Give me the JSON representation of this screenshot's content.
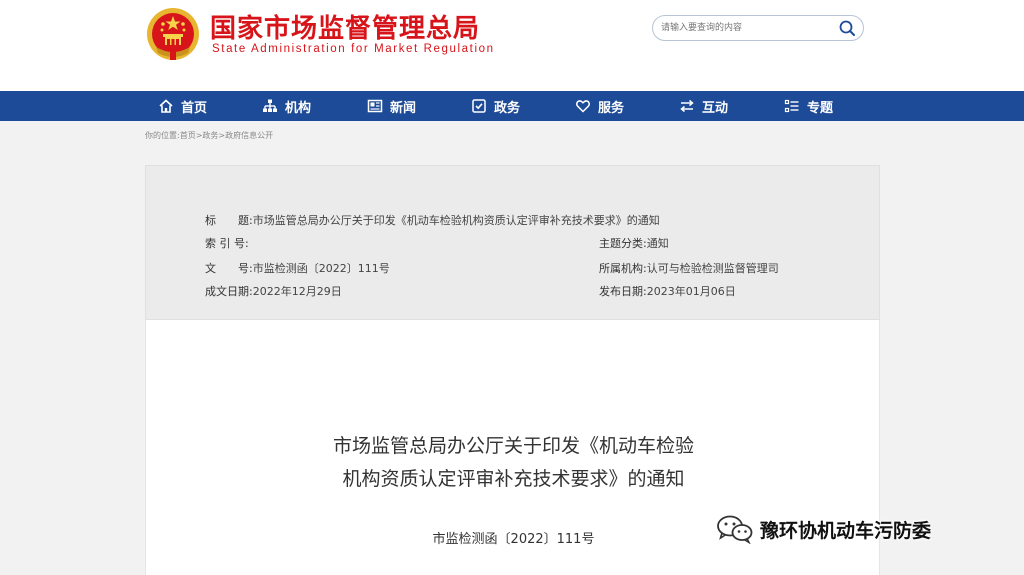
{
  "header": {
    "title_cn": "国家市场监督管理总局",
    "title_en": "State Administration for Market Regulation",
    "logo_icon": "national-emblem",
    "colors": {
      "brand_red": "#d7141a",
      "nav_blue": "#1e4b97"
    }
  },
  "search": {
    "placeholder": "请输入要查询的内容",
    "button_icon": "search-icon"
  },
  "nav": {
    "items": [
      {
        "label": "首页",
        "icon": "home-icon"
      },
      {
        "label": "机构",
        "icon": "org-chart-icon"
      },
      {
        "label": "新闻",
        "icon": "news-icon"
      },
      {
        "label": "政务",
        "icon": "government-affairs-icon"
      },
      {
        "label": "服务",
        "icon": "heart-icon"
      },
      {
        "label": "互动",
        "icon": "exchange-icon"
      },
      {
        "label": "专题",
        "icon": "topics-list-icon"
      }
    ]
  },
  "breadcrumb": {
    "prefix": "你的位置:",
    "home": "首页",
    "sep1": ">",
    "level1": "政务",
    "sep2": ">",
    "level2": "政府信息公开"
  },
  "meta": {
    "title_label": "标　　题:",
    "title_value": "市场监管总局办公厅关于印发《机动车检验机构资质认定评审补充技术要求》的通知",
    "index_label": "索 引 号:",
    "index_value": "",
    "topic_label": "主题分类:",
    "topic_value": "通知",
    "docno_label": "文　　号:",
    "docno_value": "市监检测函〔2022〕111号",
    "org_label": "所属机构:",
    "org_value": "认可与检验检测监督管理司",
    "created_label": "成文日期:",
    "created_value": "2022年12月29日",
    "published_label": "发布日期:",
    "published_value": "2023年01月06日"
  },
  "document": {
    "title_line1": "市场监管总局办公厅关于印发《机动车检验",
    "title_line2": "机构资质认定评审补充技术要求》的通知",
    "number": "市监检测函〔2022〕111号"
  },
  "watermark": {
    "text": "豫环协机动车污防委",
    "icon": "wechat-icon"
  }
}
